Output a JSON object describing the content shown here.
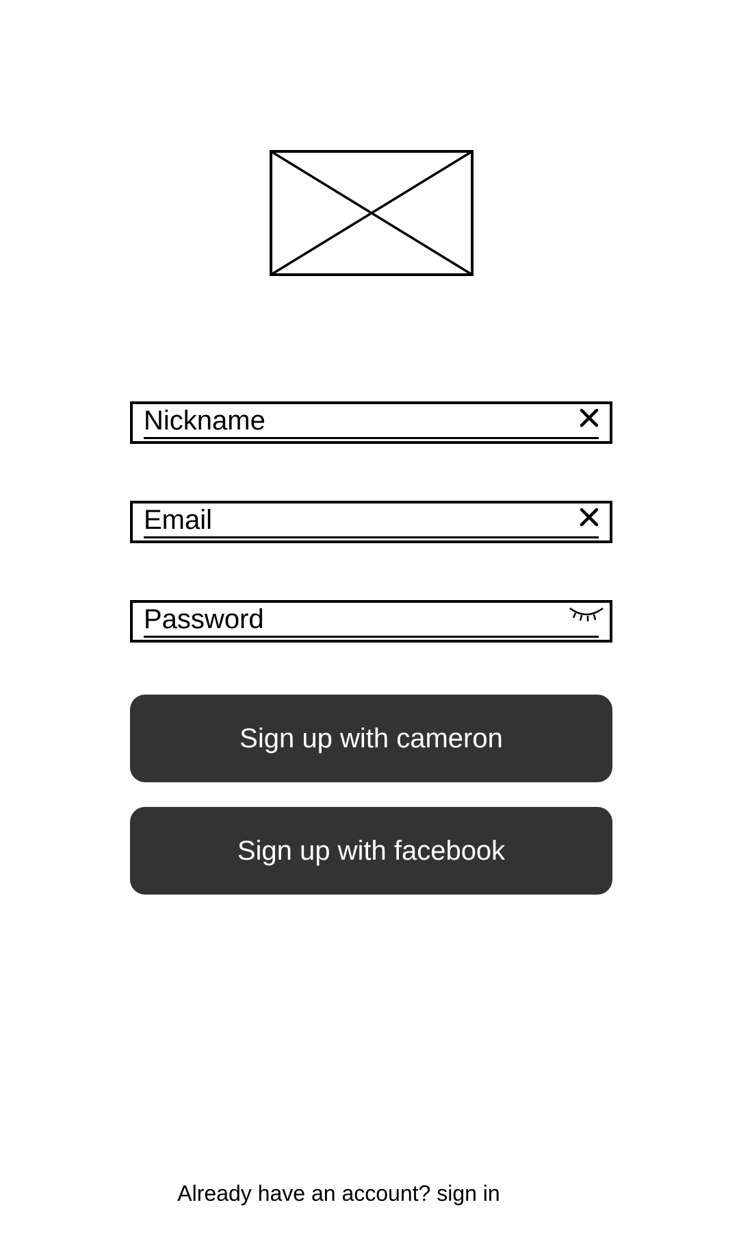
{
  "logo": {
    "icon": "image-placeholder-icon"
  },
  "form": {
    "nickname": {
      "placeholder": "Nickname",
      "value": "",
      "icon": "close-icon"
    },
    "email": {
      "placeholder": "Email",
      "value": "",
      "icon": "close-icon"
    },
    "password": {
      "placeholder": "Password",
      "value": "",
      "icon": "eye-closed-icon"
    }
  },
  "buttons": {
    "cameron_label": "Sign up with cameron",
    "facebook_label": "Sign up with facebook"
  },
  "footer": {
    "prompt": "Already have an account?",
    "link": "sign in"
  },
  "colors": {
    "button_bg": "#333333",
    "button_text": "#ffffff",
    "border": "#000000",
    "background": "#ffffff"
  }
}
